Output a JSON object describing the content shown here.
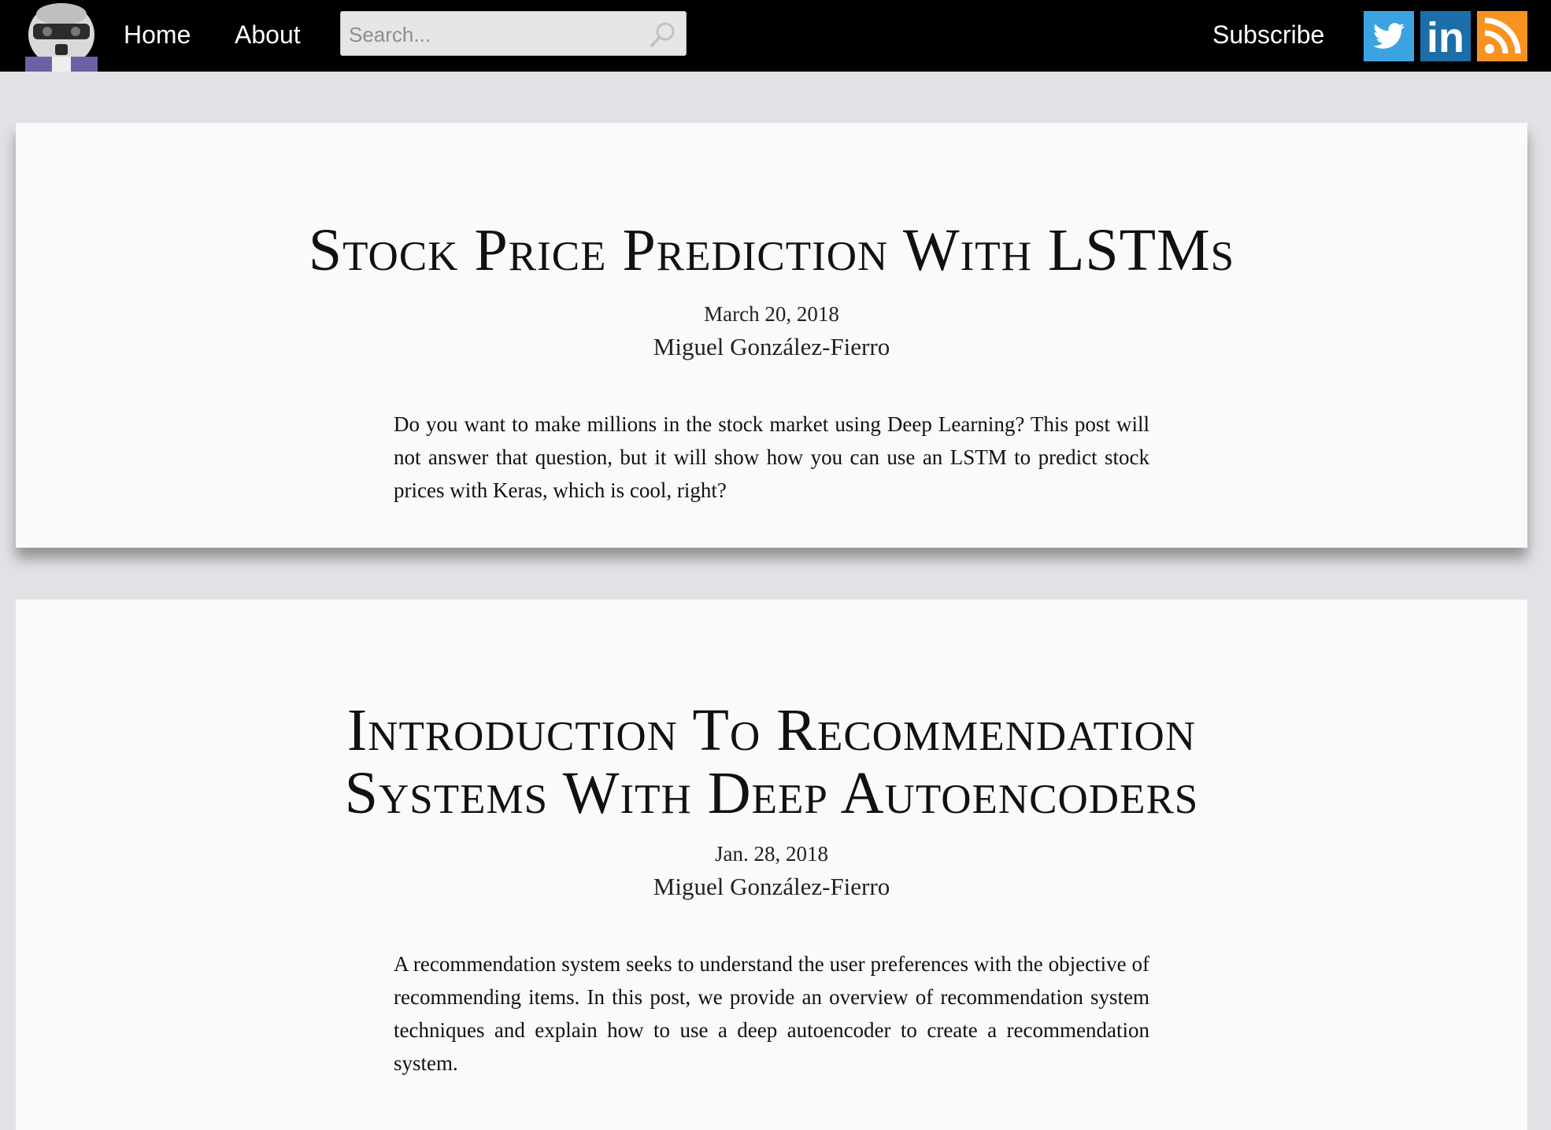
{
  "nav": {
    "home_label": "Home",
    "about_label": "About",
    "subscribe_label": "Subscribe",
    "search_placeholder": "Search..."
  },
  "social": {
    "twitter": {
      "icon": "twitter-icon",
      "color": "#3ba3e0"
    },
    "linkedin": {
      "icon": "linkedin-icon",
      "color": "#1c6ea8",
      "text": "in"
    },
    "rss": {
      "icon": "rss-icon",
      "color": "#f7931e"
    }
  },
  "posts": [
    {
      "title": "Stock Price Prediction With LSTMs",
      "date": "March 20, 2018",
      "author": "Miguel González-Fierro",
      "excerpt": "Do you want to make millions in the stock market using Deep Learning? This post will not answer that question, but it will show how you can use an LSTM to predict stock prices with Keras, which is cool, right?"
    },
    {
      "title_line1": "Introduction To Recommendation",
      "title_line2": "Systems With Deep Autoencoders",
      "date": "Jan. 28, 2018",
      "author": "Miguel González-Fierro",
      "excerpt": "A recommendation system seeks to understand the user preferences with the objective of recommending items. In this post, we provide an overview of recommendation system techniques and explain how to use a deep autoencoder to create a recommendation system."
    }
  ]
}
